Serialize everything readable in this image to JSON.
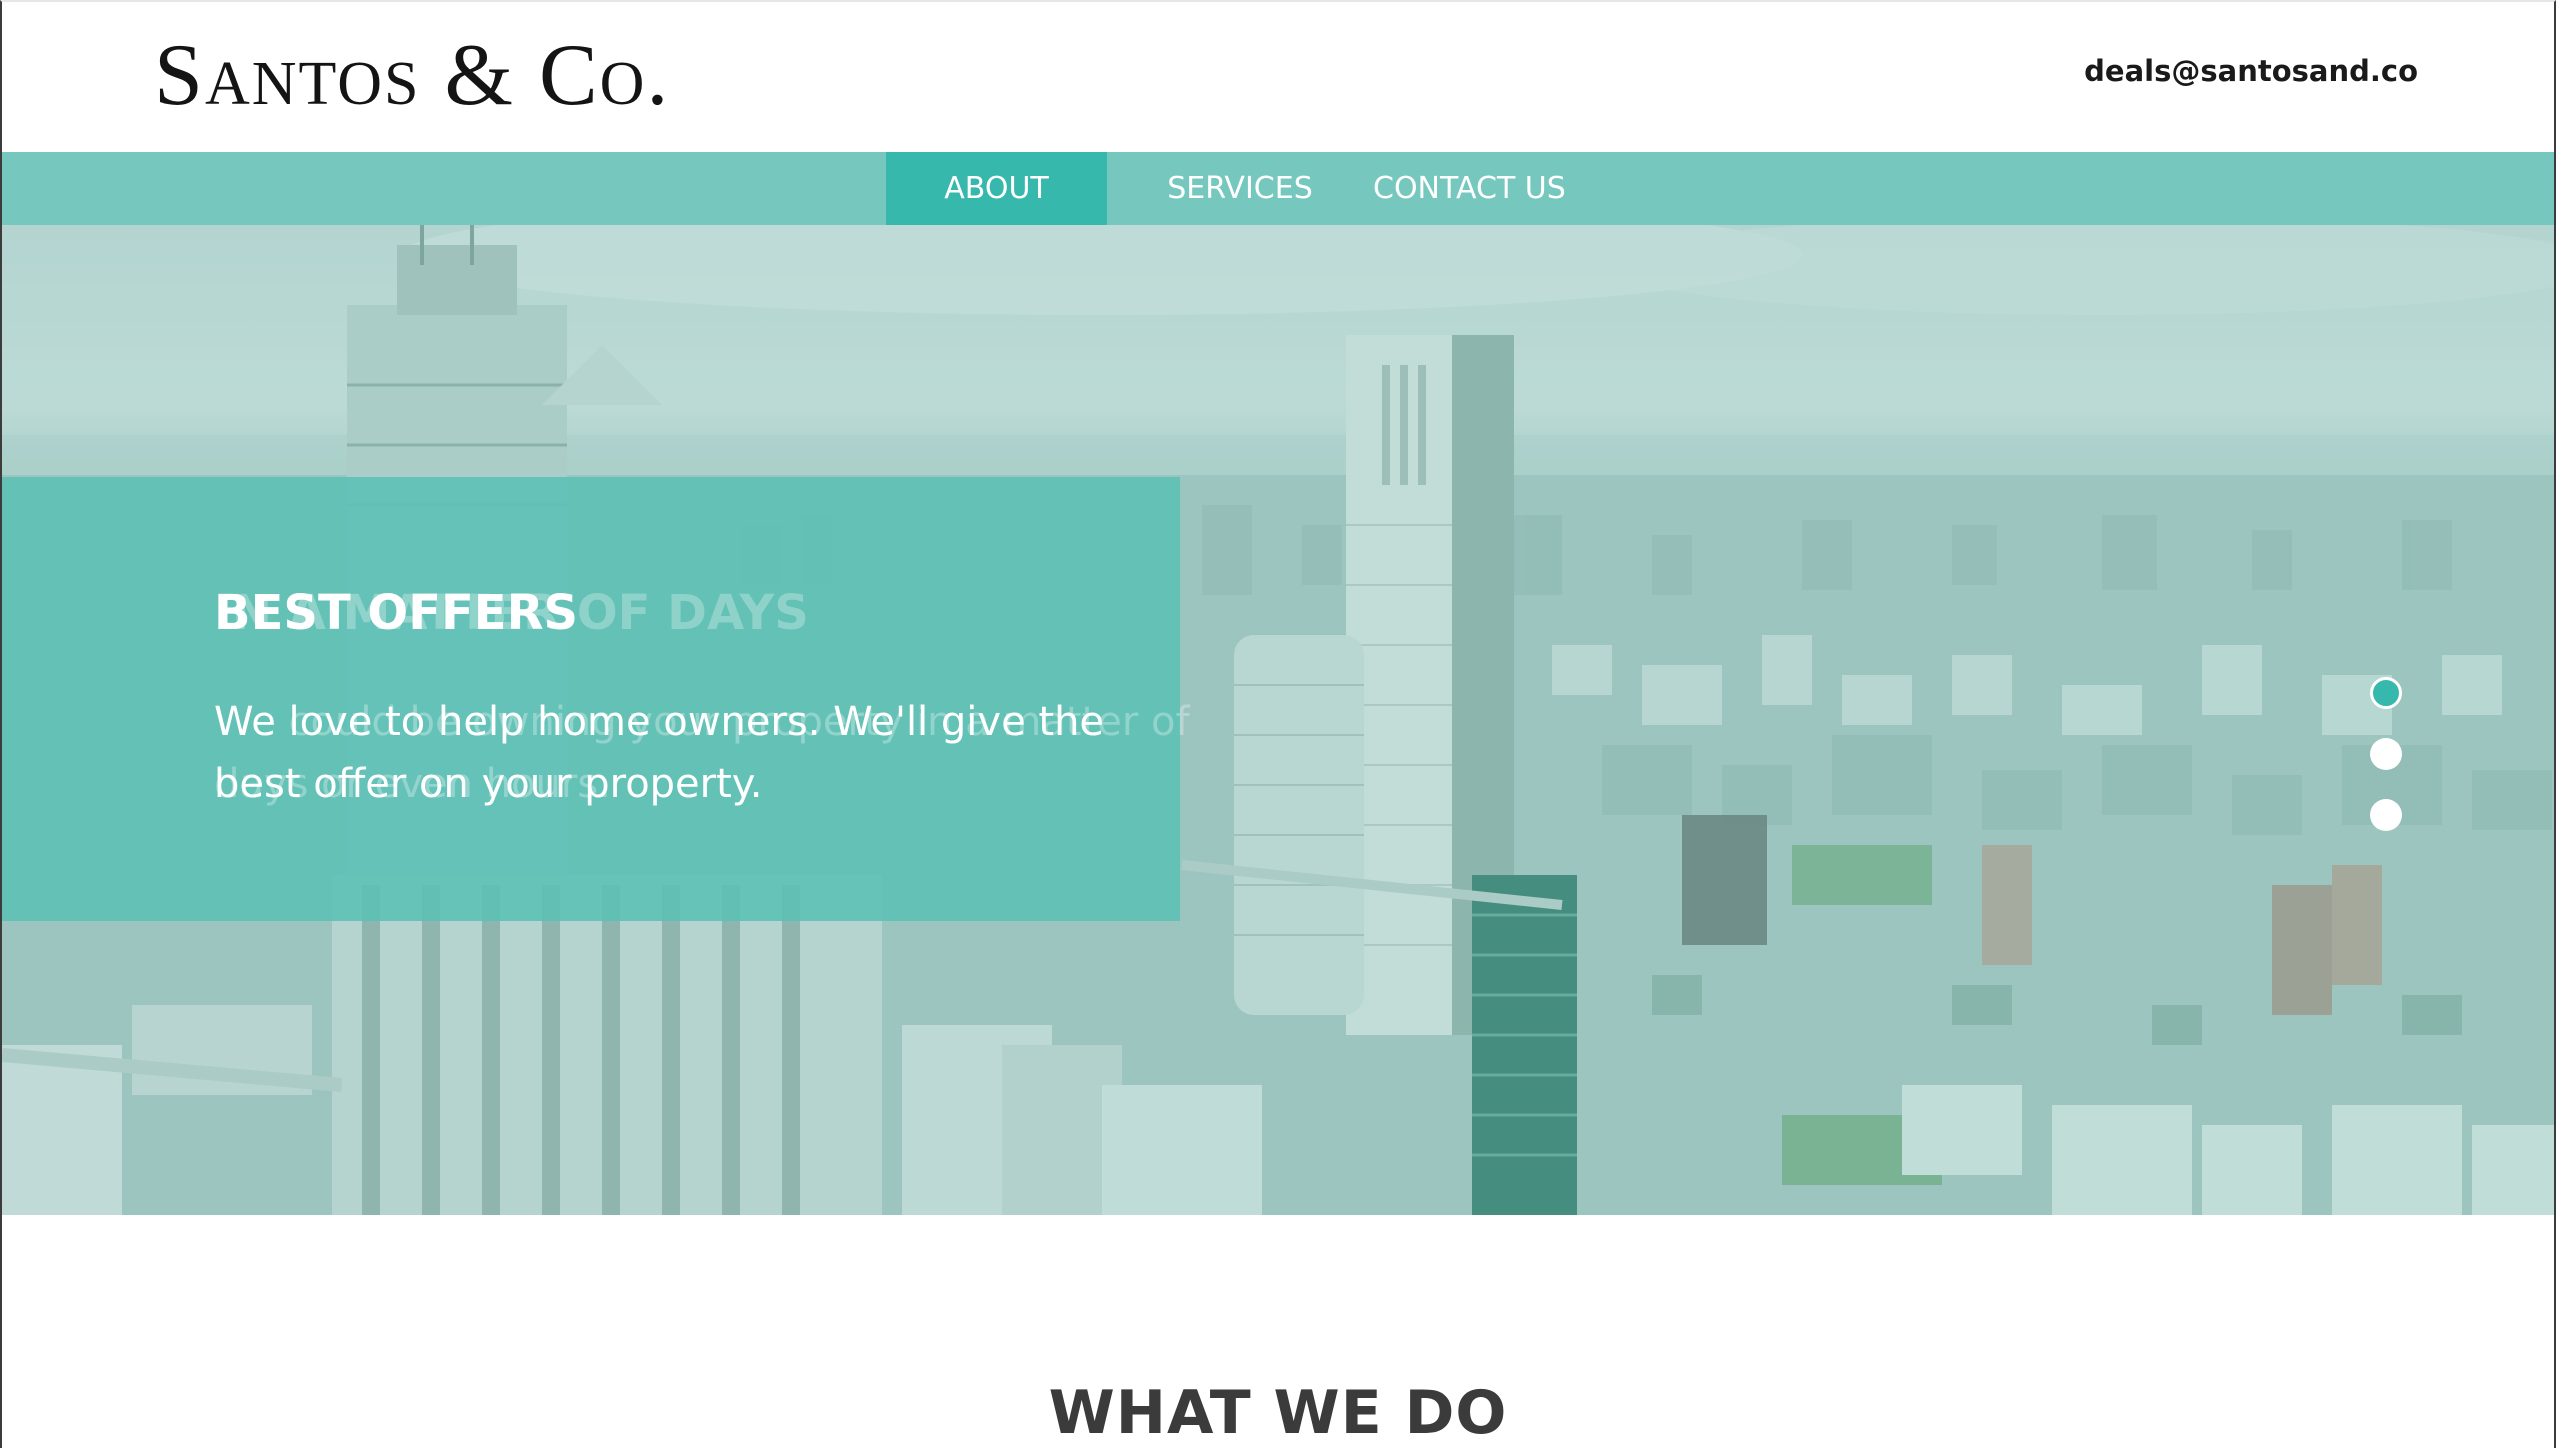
{
  "header": {
    "logo": "Santos & Co.",
    "email": "deals@santosand.co"
  },
  "nav": {
    "items": [
      {
        "label": "ABOUT",
        "active": true
      },
      {
        "label": "SERVICES",
        "active": false
      },
      {
        "label": "CONTACT US",
        "active": false
      }
    ]
  },
  "hero": {
    "slide_title": "BEST OFFERS",
    "slide_text": "We love to help home owners. We'll give the best offer on your property.",
    "prev_slide_title": "IN A MATTER OF DAYS",
    "prev_slide_text": "We could be owning your property in a matter of days or even hours.",
    "slider_dots": 3,
    "active_dot": 1
  },
  "section": {
    "title": "WHAT WE DO"
  },
  "colors": {
    "accent": "#37b8ac",
    "navbar": "#76c8bf",
    "caption_box": "#5bc0b5",
    "heading": "#3b3b3b"
  }
}
